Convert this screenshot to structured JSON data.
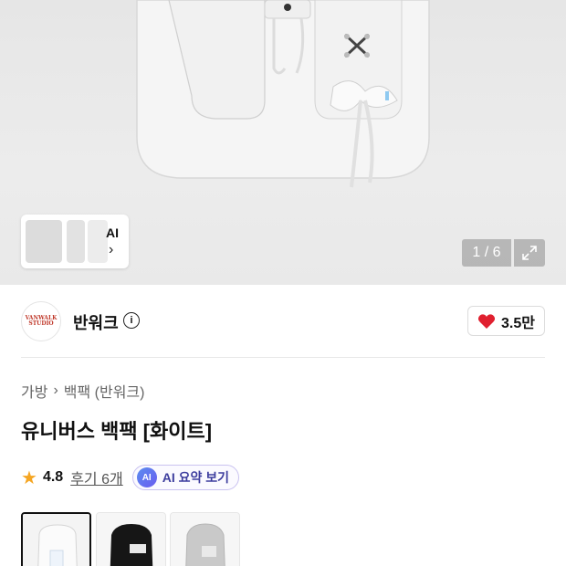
{
  "gallery": {
    "counter": "1 / 6",
    "ai_thumb_label": "AI",
    "colors": {
      "bag": "#f4f4f4",
      "background": "#e8e8e8"
    }
  },
  "seller": {
    "logo_text": "VANWALK STUDIO",
    "name": "반워크",
    "likes": "3.5만",
    "heart_color": "#e0202f"
  },
  "product": {
    "breadcrumb": [
      "가방",
      "백팩 (반워크)"
    ],
    "title": "유니버스 백팩 [화이트]",
    "rating": "4.8",
    "reviews": "후기 6개",
    "ai_badge": "AI",
    "ai_summary": "AI 요약 보기"
  },
  "options": [
    {
      "name": "white",
      "selected": true
    },
    {
      "name": "black",
      "selected": false
    },
    {
      "name": "gray",
      "selected": false
    }
  ]
}
